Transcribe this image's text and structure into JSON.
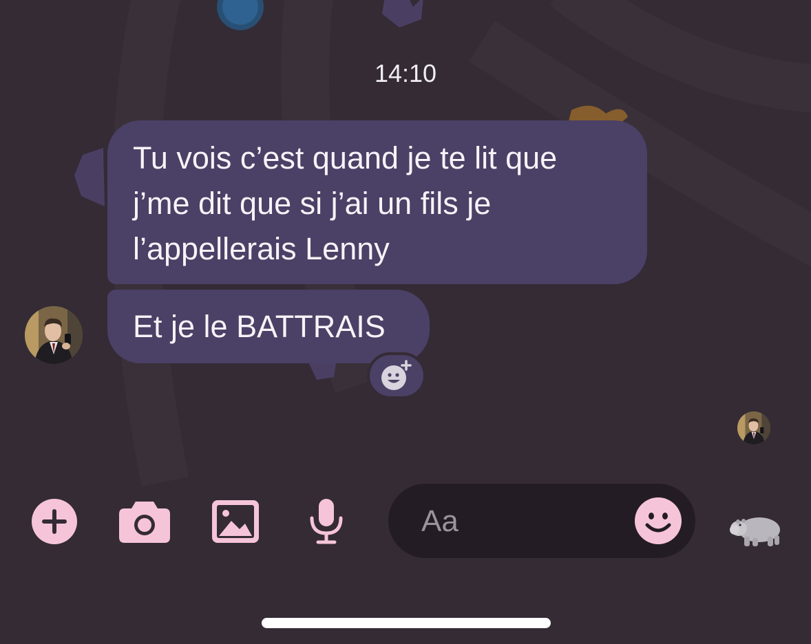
{
  "conversation": {
    "timestamp": "14:10",
    "messages": [
      {
        "lines": [
          "Tu vois c’est quand je te lit que",
          "j’me dit que si j’ai un fils je",
          "l’appellerais Lenny"
        ]
      },
      {
        "lines": [
          "Et je le BATTRAIS"
        ]
      }
    ]
  },
  "composer": {
    "placeholder": "Aa"
  },
  "toolbar": {
    "icons": [
      "plus-icon",
      "camera-icon",
      "gallery-icon",
      "microphone-icon",
      "smiley-icon",
      "hippo-emoji"
    ]
  },
  "colors": {
    "background": "#342b35",
    "bubble": "#4b4065",
    "accent_pink": "#f6c4d8",
    "composer": "#241c24",
    "text": "#f6f3f8"
  }
}
